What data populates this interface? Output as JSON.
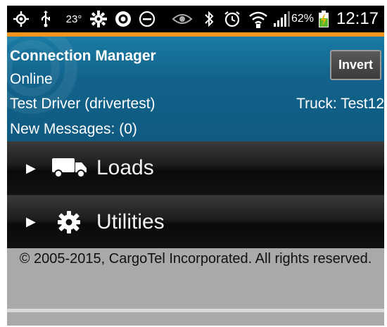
{
  "status_bar": {
    "temperature": "23°",
    "battery_percent": "62%",
    "time": "12:17",
    "icons": [
      "gps-icon",
      "usb-icon",
      "temperature-text",
      "settings-icon",
      "sync-icon",
      "do-not-disturb-icon",
      "eye-icon",
      "bluetooth-icon",
      "alarm-icon",
      "wifi-icon",
      "signal-icon",
      "battery-icon"
    ],
    "accent_color": "#f7941d"
  },
  "header": {
    "title": "Connection Manager",
    "status": "Online",
    "driver": "Test Driver (drivertest)",
    "truck": "Truck: Test12",
    "messages": "New Messages: (0)",
    "invert_label": "Invert",
    "background_color": "#12638c"
  },
  "menu": {
    "items": [
      {
        "label": "Loads",
        "icon": "truck-icon"
      },
      {
        "label": "Utilities",
        "icon": "gear-icon"
      }
    ]
  },
  "footer": {
    "copyright": "© 2005-2015, CargoTel Incorporated. All rights reserved."
  }
}
